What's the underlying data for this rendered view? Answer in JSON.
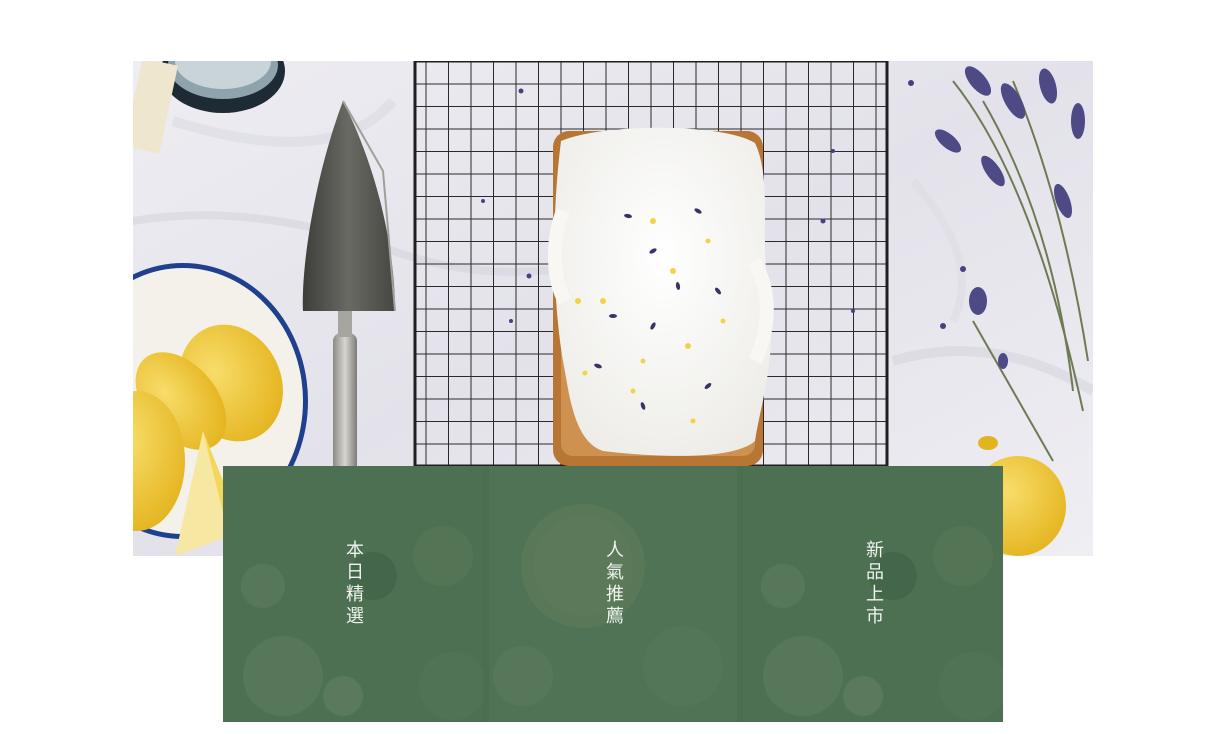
{
  "hero": {
    "image": "lemon-lavender-pound-cake-photo"
  },
  "categories": [
    {
      "label": "本日精選",
      "icon": "tile-photo-bokeh"
    },
    {
      "label": "人氣推薦",
      "icon": "tile-photo-lemon-slice"
    },
    {
      "label": "新品上市",
      "icon": "tile-photo-bokeh"
    }
  ],
  "colors": {
    "tile_overlay": "#486c50",
    "tile_text": "#eef3ee",
    "page_background": "#ffffff"
  }
}
